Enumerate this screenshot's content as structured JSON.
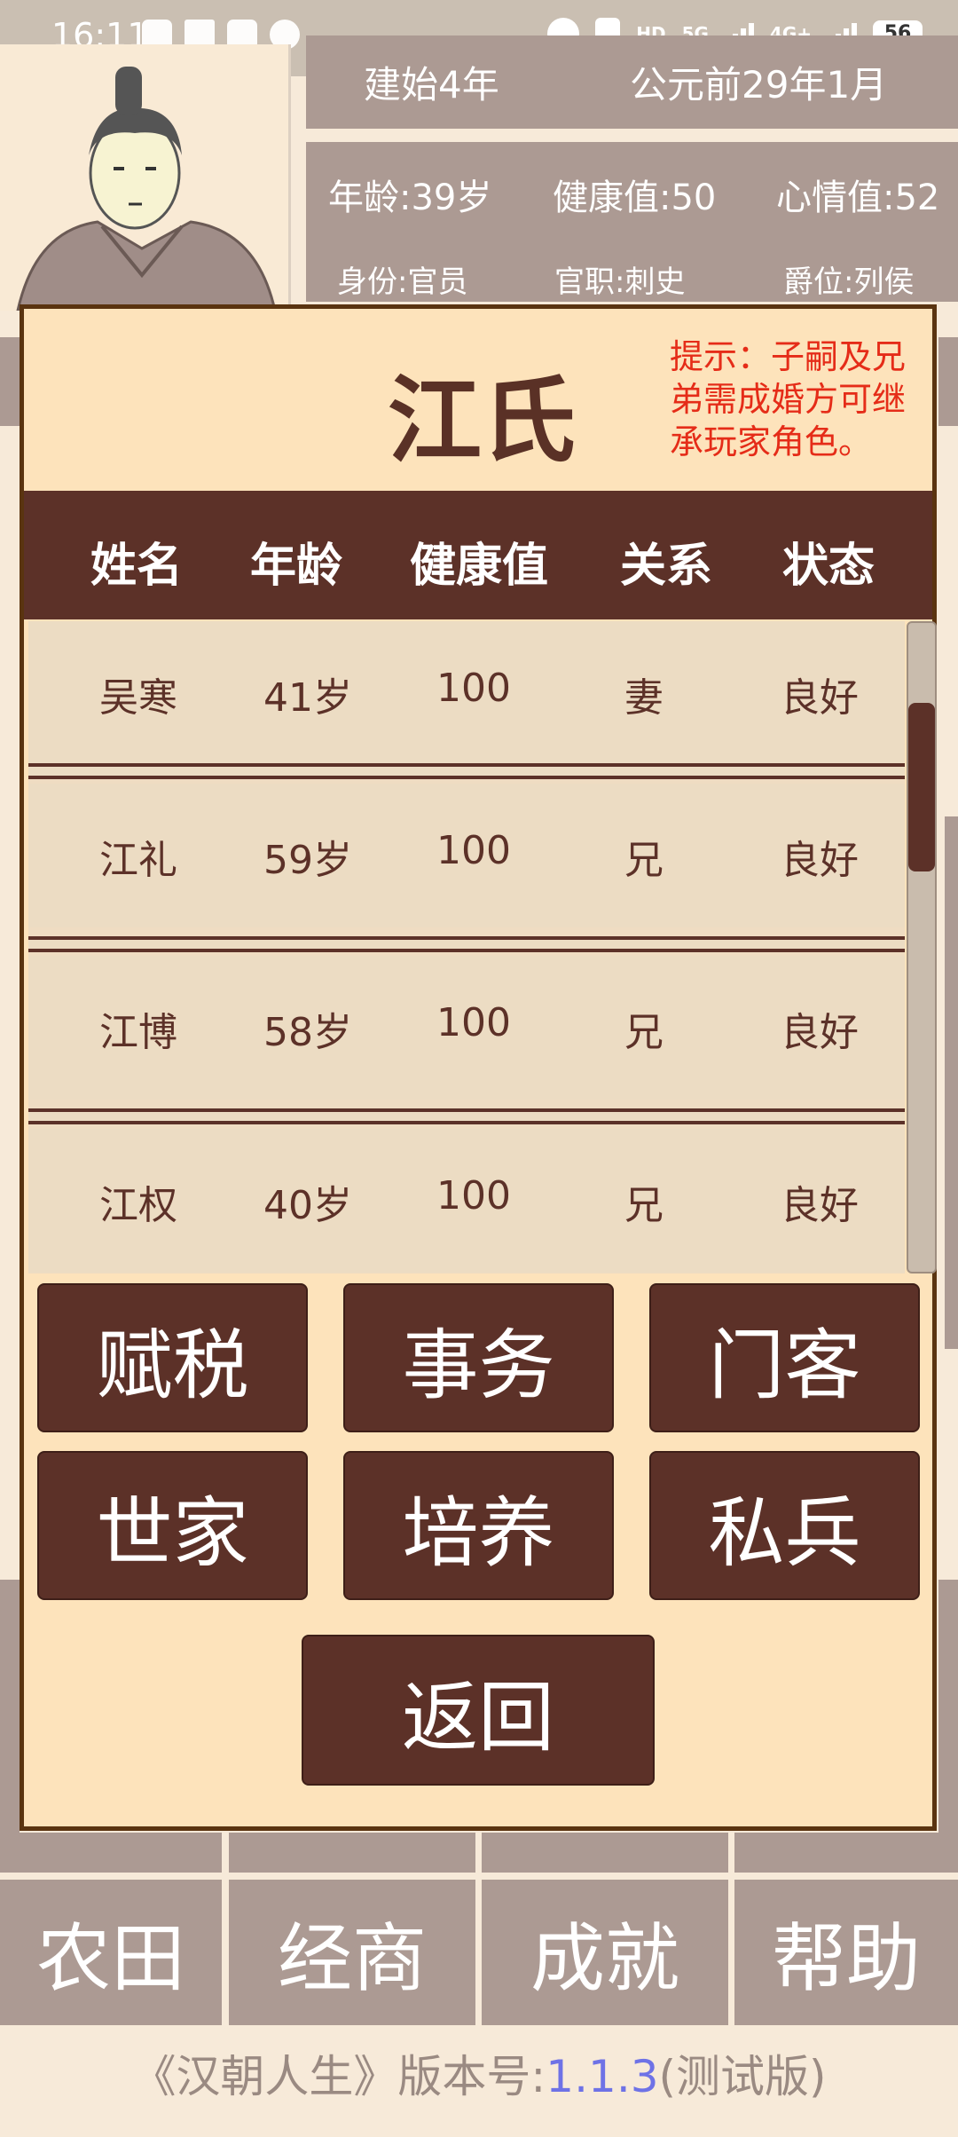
{
  "status_bar": {
    "time": "16:11",
    "battery": "56",
    "net1": "5G",
    "net2": "4G+"
  },
  "background": {
    "era": "建始4年",
    "date": "公元前29年1月",
    "age": "年龄:39岁",
    "health": "健康值:50",
    "mood": "心情值:52",
    "identity": "身份:官员",
    "post": "官职:刺史",
    "rank": "爵位:列侯"
  },
  "dialog": {
    "title": "江氏",
    "hint": "提示：子嗣及兄弟需成婚方可继承玩家角色。",
    "columns": [
      "姓名",
      "年龄",
      "健康值",
      "关系",
      "状态"
    ],
    "rows": [
      {
        "name": "吴寒",
        "age": "41岁",
        "health": "100",
        "relation": "妻",
        "status": "良好"
      },
      {
        "name": "江礼",
        "age": "59岁",
        "health": "100",
        "relation": "兄",
        "status": "良好"
      },
      {
        "name": "江博",
        "age": "58岁",
        "health": "100",
        "relation": "兄",
        "status": "良好"
      },
      {
        "name": "江权",
        "age": "40岁",
        "health": "100",
        "relation": "兄",
        "status": "良好"
      }
    ],
    "buttons": {
      "tax": "赋税",
      "affairs": "事务",
      "retainers": "门客",
      "clans": "世家",
      "training": "培养",
      "private_army": "私兵",
      "back": "返回"
    }
  },
  "bottom_menu": [
    "农田",
    "经商",
    "成就",
    "帮助"
  ],
  "footer": {
    "prefix": "《汉朝人生》版本号:",
    "version": "1.1.3",
    "suffix": "(测试版)"
  },
  "colors": {
    "primary_brown": "#5c3128",
    "panel_bg": "#fde3bb",
    "hint_red": "#e52c18",
    "version_blue": "#6e72e6"
  }
}
